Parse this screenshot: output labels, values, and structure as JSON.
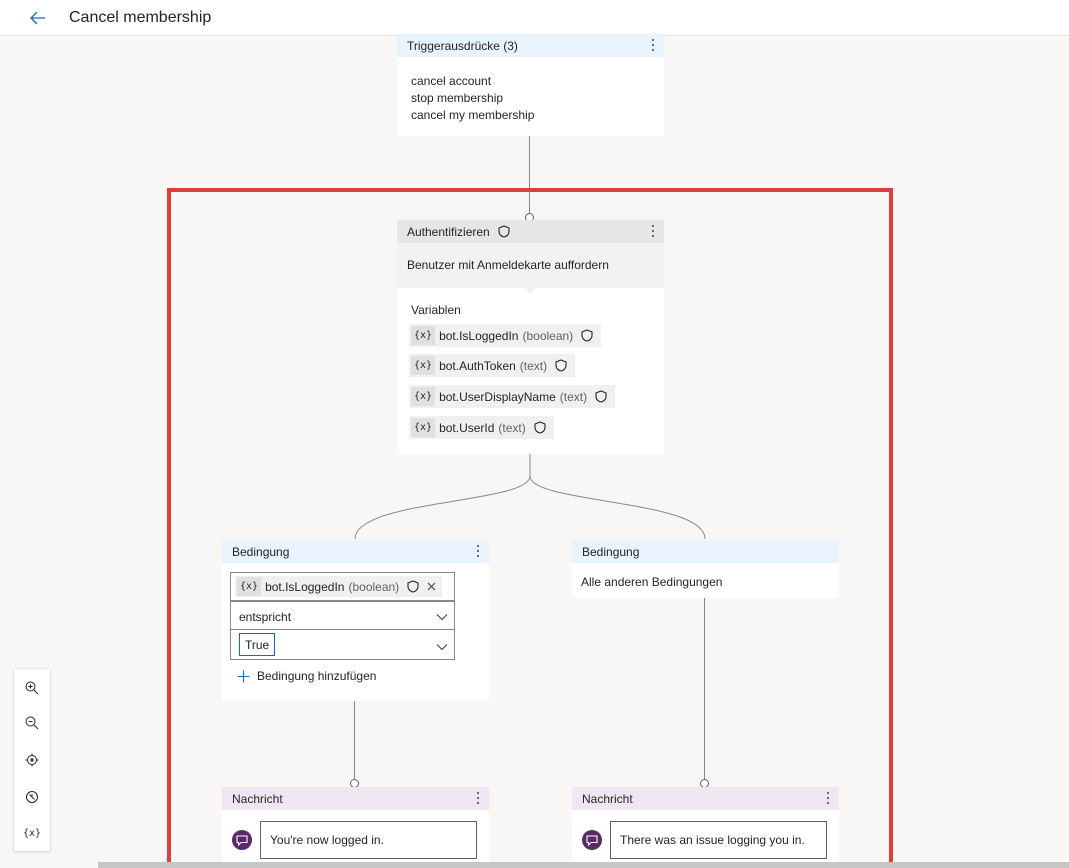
{
  "header": {
    "title": "Cancel membership"
  },
  "trigger": {
    "title": "Triggerausdrücke (3)",
    "phrases": [
      "cancel account",
      "stop membership",
      "cancel my membership"
    ]
  },
  "auth": {
    "title": "Authentifizieren",
    "subtitle": "Benutzer mit Anmeldekarte auffordern",
    "variables_label": "Variablen",
    "variables": [
      {
        "token": "{x}",
        "name": "bot.IsLoggedIn",
        "type": "(boolean)"
      },
      {
        "token": "{x}",
        "name": "bot.AuthToken",
        "type": "(text)"
      },
      {
        "token": "{x}",
        "name": "bot.UserDisplayName",
        "type": "(text)"
      },
      {
        "token": "{x}",
        "name": "bot.UserId",
        "type": "(text)"
      }
    ]
  },
  "condition_left": {
    "title": "Bedingung",
    "variable": {
      "token": "{x}",
      "name": "bot.IsLoggedIn",
      "type": "(boolean)"
    },
    "operator": "entspricht",
    "value": "True",
    "add_label": "Bedingung hinzufügen"
  },
  "condition_right": {
    "title": "Bedingung",
    "text": "Alle anderen Bedingungen"
  },
  "message_left": {
    "title": "Nachricht",
    "text": "You're now logged in."
  },
  "message_right": {
    "title": "Nachricht",
    "text": "There was an issue logging you in."
  },
  "zoom_controls": {
    "variables_label": "{x}",
    "icons": [
      "zoom-in-icon",
      "zoom-out-icon",
      "locate-icon",
      "reset-icon",
      "variables-icon"
    ]
  },
  "colors": {
    "highlight": "#e23d3d",
    "accent": "#0f6cbd",
    "message_icon": "#5b2a6b"
  }
}
